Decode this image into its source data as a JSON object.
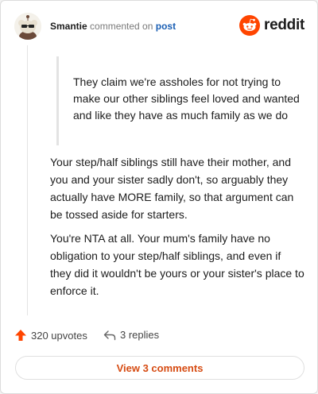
{
  "header": {
    "username": "Smantie",
    "action_text": "commented on",
    "post_link": "post"
  },
  "brand": {
    "name": "reddit",
    "logo_icon": "reddit-alien-icon",
    "accent_color": "#ff4500"
  },
  "comment": {
    "quote": "They claim we're assholes for not trying to make our other siblings feel loved and wanted and like they have as much family as we do",
    "paragraphs": [
      "Your step/half siblings still have their mother, and you and your sister sadly don't, so arguably they actually have MORE family, so that argument can be tossed aside for starters.",
      "You're NTA at all. Your mum's family have no obligation to your step/half siblings, and even if they did it wouldn't be yours or your sister's place to enforce it."
    ]
  },
  "footer": {
    "upvotes": "320 upvotes",
    "upvote_icon": "upvote-arrow-icon",
    "replies": "3 replies",
    "reply_icon": "reply-arrow-icon",
    "view_comments": "View 3 comments"
  }
}
